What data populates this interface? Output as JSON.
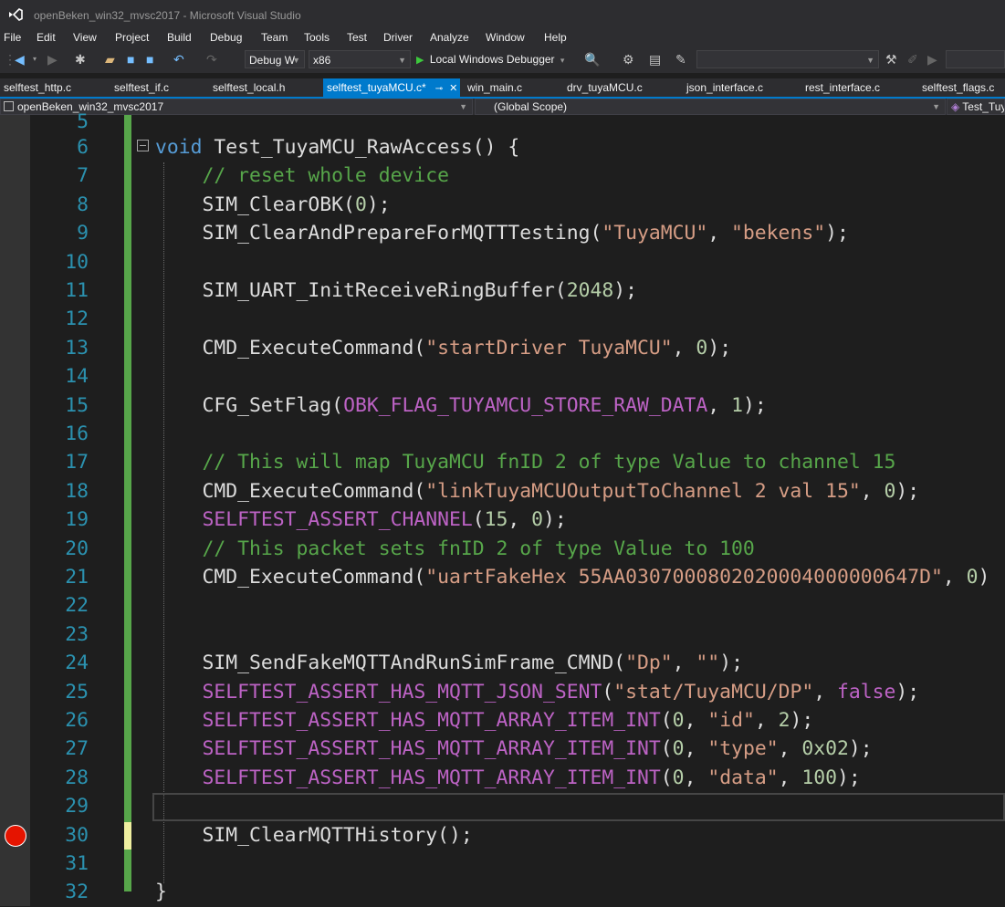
{
  "window": {
    "title": "openBeken_win32_mvsc2017 - Microsoft Visual Studio"
  },
  "menu": [
    "File",
    "Edit",
    "View",
    "Project",
    "Build",
    "Debug",
    "Team",
    "Tools",
    "Test",
    "Driver",
    "Analyze",
    "Window",
    "Help"
  ],
  "toolbar": {
    "configuration": "Debug W",
    "platform": "x86",
    "debugger": "Local Windows Debugger"
  },
  "tabs": [
    {
      "label": "selftest_http.c"
    },
    {
      "label": "selftest_if.c"
    },
    {
      "label": "selftest_local.h"
    },
    {
      "label": "selftest_tuyaMCU.c*"
    },
    {
      "label": "win_main.c"
    },
    {
      "label": "drv_tuyaMCU.c"
    },
    {
      "label": "json_interface.c"
    },
    {
      "label": "rest_interface.c"
    },
    {
      "label": "selftest_flags.c"
    }
  ],
  "nav": {
    "project": "openBeken_win32_mvsc2017",
    "scope": "(Global Scope)",
    "member": "Test_Tuy"
  },
  "code": {
    "first_partial": "5",
    "lines": [
      {
        "n": "6",
        "tokens": [
          {
            "c": "kw",
            "t": "void"
          },
          {
            "c": "fn",
            "t": " Test_TuyaMCU_RawAccess() {"
          }
        ]
      },
      {
        "n": "7",
        "tokens": [
          {
            "c": "fn",
            "t": "    "
          },
          {
            "c": "cm",
            "t": "// reset whole device"
          }
        ]
      },
      {
        "n": "8",
        "tokens": [
          {
            "c": "fn",
            "t": "    SIM_ClearOBK("
          },
          {
            "c": "nm",
            "t": "0"
          },
          {
            "c": "fn",
            "t": ");"
          }
        ]
      },
      {
        "n": "9",
        "tokens": [
          {
            "c": "fn",
            "t": "    SIM_ClearAndPrepareForMQTTTesting("
          },
          {
            "c": "st",
            "t": "\"TuyaMCU\""
          },
          {
            "c": "fn",
            "t": ", "
          },
          {
            "c": "st",
            "t": "\"bekens\""
          },
          {
            "c": "fn",
            "t": ");"
          }
        ]
      },
      {
        "n": "10",
        "tokens": []
      },
      {
        "n": "11",
        "tokens": [
          {
            "c": "fn",
            "t": "    SIM_UART_InitReceiveRingBuffer("
          },
          {
            "c": "nm",
            "t": "2048"
          },
          {
            "c": "fn",
            "t": ");"
          }
        ]
      },
      {
        "n": "12",
        "tokens": []
      },
      {
        "n": "13",
        "tokens": [
          {
            "c": "fn",
            "t": "    CMD_ExecuteCommand("
          },
          {
            "c": "st",
            "t": "\"startDriver TuyaMCU\""
          },
          {
            "c": "fn",
            "t": ", "
          },
          {
            "c": "nm",
            "t": "0"
          },
          {
            "c": "fn",
            "t": ");"
          }
        ]
      },
      {
        "n": "14",
        "tokens": []
      },
      {
        "n": "15",
        "tokens": [
          {
            "c": "fn",
            "t": "    CFG_SetFlag("
          },
          {
            "c": "mc",
            "t": "OBK_FLAG_TUYAMCU_STORE_RAW_DATA"
          },
          {
            "c": "fn",
            "t": ", "
          },
          {
            "c": "nm",
            "t": "1"
          },
          {
            "c": "fn",
            "t": ");"
          }
        ]
      },
      {
        "n": "16",
        "tokens": []
      },
      {
        "n": "17",
        "tokens": [
          {
            "c": "fn",
            "t": "    "
          },
          {
            "c": "cm",
            "t": "// This will map TuyaMCU fnID 2 of type Value to channel 15"
          }
        ]
      },
      {
        "n": "18",
        "tokens": [
          {
            "c": "fn",
            "t": "    CMD_ExecuteCommand("
          },
          {
            "c": "st",
            "t": "\"linkTuyaMCUOutputToChannel 2 val 15\""
          },
          {
            "c": "fn",
            "t": ", "
          },
          {
            "c": "nm",
            "t": "0"
          },
          {
            "c": "fn",
            "t": ");"
          }
        ]
      },
      {
        "n": "19",
        "tokens": [
          {
            "c": "fn",
            "t": "    "
          },
          {
            "c": "mc",
            "t": "SELFTEST_ASSERT_CHANNEL"
          },
          {
            "c": "fn",
            "t": "("
          },
          {
            "c": "nm",
            "t": "15"
          },
          {
            "c": "fn",
            "t": ", "
          },
          {
            "c": "nm",
            "t": "0"
          },
          {
            "c": "fn",
            "t": ");"
          }
        ]
      },
      {
        "n": "20",
        "tokens": [
          {
            "c": "fn",
            "t": "    "
          },
          {
            "c": "cm",
            "t": "// This packet sets fnID 2 of type Value to 100"
          }
        ]
      },
      {
        "n": "21",
        "tokens": [
          {
            "c": "fn",
            "t": "    CMD_ExecuteCommand("
          },
          {
            "c": "st",
            "t": "\"uartFakeHex 55AA0307000802020004000000647D\""
          },
          {
            "c": "fn",
            "t": ", "
          },
          {
            "c": "nm",
            "t": "0"
          },
          {
            "c": "fn",
            "t": ")"
          }
        ]
      },
      {
        "n": "22",
        "tokens": []
      },
      {
        "n": "23",
        "tokens": []
      },
      {
        "n": "24",
        "tokens": [
          {
            "c": "fn",
            "t": "    SIM_SendFakeMQTTAndRunSimFrame_CMND("
          },
          {
            "c": "st",
            "t": "\"Dp\""
          },
          {
            "c": "fn",
            "t": ", "
          },
          {
            "c": "st",
            "t": "\"\""
          },
          {
            "c": "fn",
            "t": ");"
          }
        ]
      },
      {
        "n": "25",
        "tokens": [
          {
            "c": "fn",
            "t": "    "
          },
          {
            "c": "mc",
            "t": "SELFTEST_ASSERT_HAS_MQTT_JSON_SENT"
          },
          {
            "c": "fn",
            "t": "("
          },
          {
            "c": "st",
            "t": "\"stat/TuyaMCU/DP\""
          },
          {
            "c": "fn",
            "t": ", "
          },
          {
            "c": "mc",
            "t": "false"
          },
          {
            "c": "fn",
            "t": ");"
          }
        ]
      },
      {
        "n": "26",
        "tokens": [
          {
            "c": "fn",
            "t": "    "
          },
          {
            "c": "mc",
            "t": "SELFTEST_ASSERT_HAS_MQTT_ARRAY_ITEM_INT"
          },
          {
            "c": "fn",
            "t": "("
          },
          {
            "c": "nm",
            "t": "0"
          },
          {
            "c": "fn",
            "t": ", "
          },
          {
            "c": "st",
            "t": "\"id\""
          },
          {
            "c": "fn",
            "t": ", "
          },
          {
            "c": "nm",
            "t": "2"
          },
          {
            "c": "fn",
            "t": ");"
          }
        ]
      },
      {
        "n": "27",
        "tokens": [
          {
            "c": "fn",
            "t": "    "
          },
          {
            "c": "mc",
            "t": "SELFTEST_ASSERT_HAS_MQTT_ARRAY_ITEM_INT"
          },
          {
            "c": "fn",
            "t": "("
          },
          {
            "c": "nm",
            "t": "0"
          },
          {
            "c": "fn",
            "t": ", "
          },
          {
            "c": "st",
            "t": "\"type\""
          },
          {
            "c": "fn",
            "t": ", "
          },
          {
            "c": "nm",
            "t": "0x02"
          },
          {
            "c": "fn",
            "t": ");"
          }
        ]
      },
      {
        "n": "28",
        "tokens": [
          {
            "c": "fn",
            "t": "    "
          },
          {
            "c": "mc",
            "t": "SELFTEST_ASSERT_HAS_MQTT_ARRAY_ITEM_INT"
          },
          {
            "c": "fn",
            "t": "("
          },
          {
            "c": "nm",
            "t": "0"
          },
          {
            "c": "fn",
            "t": ", "
          },
          {
            "c": "st",
            "t": "\"data\""
          },
          {
            "c": "fn",
            "t": ", "
          },
          {
            "c": "nm",
            "t": "100"
          },
          {
            "c": "fn",
            "t": ");"
          }
        ]
      },
      {
        "n": "29",
        "tokens": []
      },
      {
        "n": "30",
        "tokens": [
          {
            "c": "fn",
            "t": "    SIM_ClearMQTTHistory();"
          }
        ]
      },
      {
        "n": "31",
        "tokens": []
      },
      {
        "n": "32",
        "tokens": [
          {
            "c": "fn",
            "t": "}"
          }
        ]
      }
    ]
  }
}
